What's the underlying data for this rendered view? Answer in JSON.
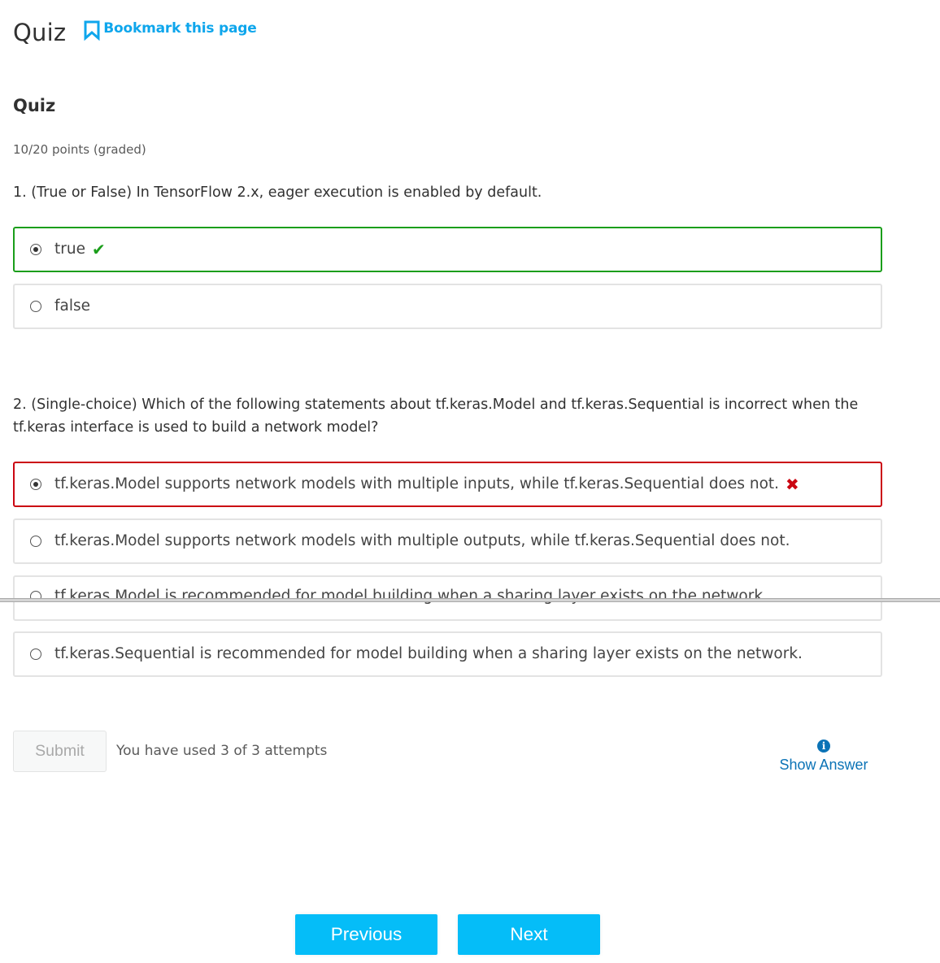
{
  "header": {
    "title": "Quiz",
    "bookmark_label": "Bookmark this page"
  },
  "section": {
    "title": "Quiz",
    "points": "10/20 points (graded)"
  },
  "questions": [
    {
      "text": "1. (True or False) In TensorFlow 2.x, eager execution is enabled by default.",
      "options": [
        {
          "label": "true",
          "selected": true,
          "status": "correct",
          "mark_icon": "checkmark-icon",
          "mark": "✔"
        },
        {
          "label": "false",
          "selected": false,
          "status": "none"
        }
      ]
    },
    {
      "text": "2. (Single-choice) Which of the following statements about tf.keras.Model and tf.keras.Sequential is incorrect when the tf.keras interface is used to build a network model?",
      "options": [
        {
          "label": "tf.keras.Model supports network models with multiple inputs, while tf.keras.Sequential does not.",
          "selected": true,
          "status": "incorrect",
          "mark_icon": "cross-icon",
          "mark": "✖"
        },
        {
          "label": "tf.keras.Model supports network models with multiple outputs, while tf.keras.Sequential does not.",
          "selected": false,
          "status": "none"
        },
        {
          "label": "tf.keras.Model is recommended for model building when a sharing layer exists on the network.",
          "selected": false,
          "status": "none"
        },
        {
          "label": "tf.keras.Sequential is recommended for model building when a sharing layer exists on the network.",
          "selected": false,
          "status": "none"
        }
      ]
    }
  ],
  "actions": {
    "submit_label": "Submit",
    "attempts_text": "You have used 3 of 3 attempts",
    "show_answer_label": "Show Answer",
    "info_icon_glyph": "i"
  },
  "navigation": {
    "previous_label": "Previous",
    "next_label": "Next"
  },
  "colors": {
    "accent": "#05bdf8",
    "link": "#0ea6ec",
    "correct": "#1b9e1b",
    "incorrect": "#cb0712",
    "show_answer": "#0b73b6"
  }
}
